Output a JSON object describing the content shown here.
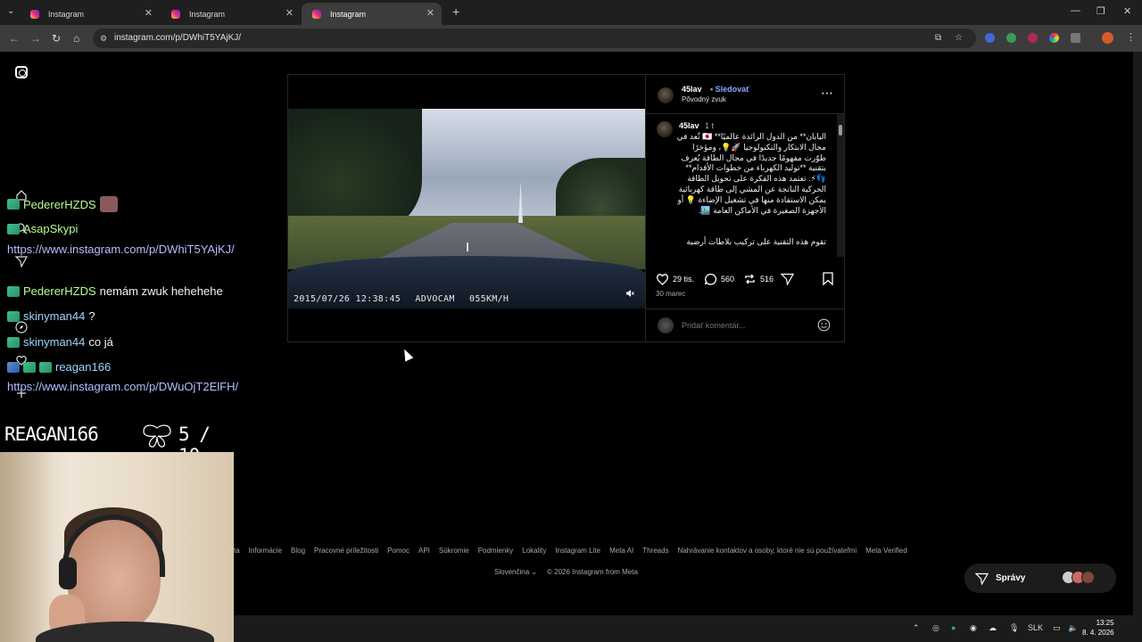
{
  "browser": {
    "tabs": [
      {
        "title": "Instagram",
        "active": false
      },
      {
        "title": "Instagram",
        "active": false
      },
      {
        "title": "Instagram",
        "active": true
      }
    ],
    "new_tab": "+",
    "url": "instagram.com/p/DWhiT5YAjKJ/"
  },
  "post": {
    "username": "45lav",
    "follow_label": "Sledovať",
    "separator": "•",
    "audio": "Pôvodný zvuk",
    "caption_user": "45lav",
    "caption_time": "1 t",
    "caption_text": "اليابان** من الدول الرائدة عالميًا** 🇯🇵 تُعد في مجال الابتكار والتكنولوجيا 🚀💡، ومؤخرًا طوّرت مفهومًا جديدًا في مجال الطاقة يُعرف بتقنية **توليد الكهرباء من خطوات الأقدام** 👣⚡. تعتمد هذه الفكرة على تحويل الطاقة الحركية الناتجة عن المشي إلى طاقة كهربائية يمكن الاستفادة منها في تشغيل الإضاءة 💡 أو الأجهزة الصغيرة في الأماكن العامة 🏙️.",
    "caption_text_2": "تقوم هذه التقنية على تركيب بلاطات أرضية",
    "video_osd_date": "2015/07/26 12:38:45",
    "video_osd_brand": "ADVOCAM",
    "video_osd_speed": "055KM/H",
    "likes": "29 tis.",
    "comments": "560",
    "reposts": "516",
    "date": "30 marec",
    "comment_placeholder": "Pridať komentár..."
  },
  "footer": {
    "links": [
      "ta",
      "Informácie",
      "Blog",
      "Pracovné príležitosti",
      "Pomoc",
      "API",
      "Súkromie",
      "Podmienky",
      "Lokality",
      "Instagram Lite",
      "Meta AI",
      "Threads",
      "Nahrávanie kontaktov a osoby, ktoré nie sú používateľmi",
      "Meta Verified"
    ],
    "language": "Slovenčina",
    "copyright": "© 2026 Instagram from Meta"
  },
  "messages": {
    "label": "Správy"
  },
  "stream_chat": [
    {
      "user": "PedererHZDS",
      "text": ""
    },
    {
      "user": "AsapSkypi",
      "text": ""
    },
    {
      "user": "",
      "text": "https://www.instagram.com/p/DWhiT5YAjKJ/"
    },
    {
      "user": "PedererHZDS",
      "text": "nemám zwuk hehehehe"
    },
    {
      "user": "skinyman44",
      "text": "?"
    },
    {
      "user": "skinyman44",
      "text": "co já"
    },
    {
      "user": "reagan166",
      "text": ""
    },
    {
      "user": "",
      "text": "https://www.instagram.com/p/DWuOjT2ElFH/"
    }
  ],
  "stream_overlay": {
    "name": "REAGAN166",
    "score": "5 / 10"
  },
  "taskbar": {
    "lang": "SLK",
    "time": "13:25",
    "date": "8. 4. 2026"
  }
}
